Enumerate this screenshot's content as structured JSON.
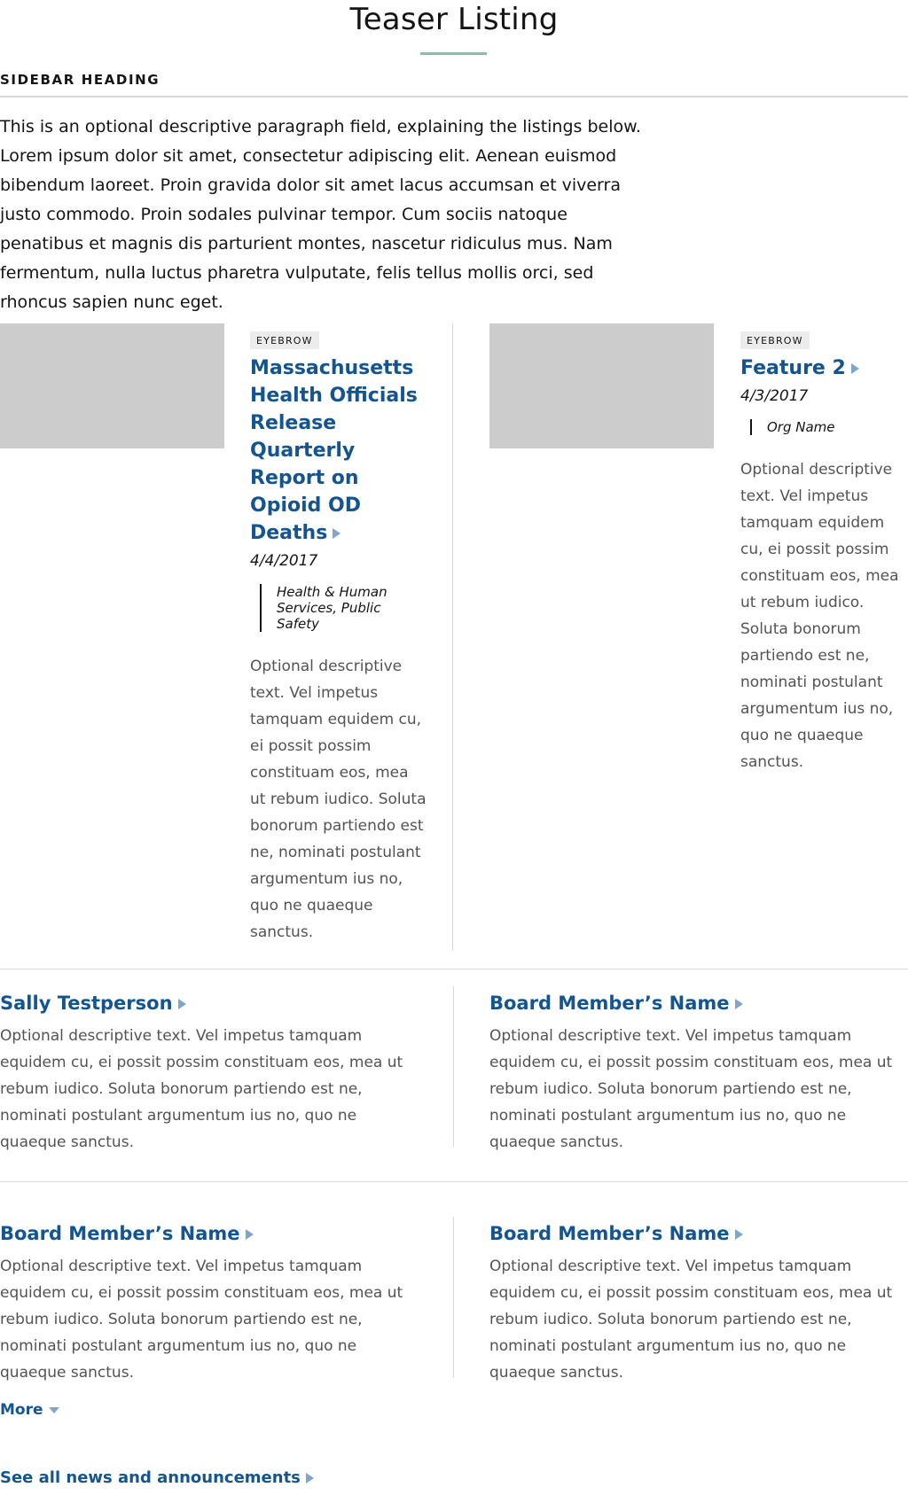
{
  "page": {
    "title": "Teaser Listing",
    "sidebar_heading": "SIDEBAR HEADING",
    "intro": "This is an optional descriptive paragraph field, explaining the listings below. Lorem ipsum dolor sit amet, consectetur adipiscing elit. Aenean euismod bibendum laoreet. Proin gravida dolor sit amet lacus accumsan et viverra justo commodo. Proin sodales pulvinar tempor. Cum sociis natoque penatibus et magnis dis parturient montes, nascetur ridiculus mus. Nam fermentum, nulla luctus pharetra vulputate, felis tellus mollis orci, sed rhoncus sapien nunc eget."
  },
  "features": [
    {
      "eyebrow": "EYEBROW",
      "title": "Massachusetts Health Officials Release Quarterly Report on Opioid OD Deaths",
      "date": "4/4/2017",
      "org": "Health & Human Services, Public Safety",
      "description": "Optional descriptive text. Vel impetus tamquam equidem cu, ei possit possim constituam eos, mea ut rebum iudico. Soluta bonorum partiendo est ne, nominati postulant argumentum ius no, quo ne quaeque sanctus."
    },
    {
      "eyebrow": "EYEBROW",
      "title": "Feature 2",
      "date": "4/3/2017",
      "org": "Org Name",
      "description": "Optional descriptive text. Vel impetus tamquam equidem cu, ei possit possim constituam eos, mea ut rebum iudico. Soluta bonorum partiendo est ne, nominati postulant argumentum ius no, quo ne quaeque sanctus."
    }
  ],
  "teasers": [
    {
      "title": "Sally Testperson",
      "description": "Optional descriptive text. Vel impetus tamquam equidem cu, ei possit possim constituam eos, mea ut rebum iudico. Soluta bonorum partiendo est ne, nominati postulant argumentum ius no, quo ne quaeque sanctus."
    },
    {
      "title": "Board Member’s Name",
      "description": "Optional descriptive text. Vel impetus tamquam equidem cu, ei possit possim constituam eos, mea ut rebum iudico. Soluta bonorum partiendo est ne, nominati postulant argumentum ius no, quo ne quaeque sanctus."
    },
    {
      "title": "Board Member’s Name",
      "description": "Optional descriptive text. Vel impetus tamquam equidem cu, ei possit possim constituam eos, mea ut rebum iudico. Soluta bonorum partiendo est ne, nominati postulant argumentum ius no, quo ne quaeque sanctus."
    },
    {
      "title": "Board Member’s Name",
      "description": "Optional descriptive text. Vel impetus tamquam equidem cu, ei possit possim constituam eos, mea ut rebum iudico. Soluta bonorum partiendo est ne, nominati postulant argumentum ius no, quo ne quaeque sanctus."
    }
  ],
  "links": {
    "more": "More",
    "see_all": "See all news and announcements"
  },
  "icons": {
    "arrow": "arrow-right-icon",
    "chevron": "chevron-down-icon"
  },
  "colors": {
    "link": "#14558f",
    "accent_underline": "#88c0a3",
    "arrow": "#7fa6c9",
    "image_placeholder": "#cccccc"
  }
}
